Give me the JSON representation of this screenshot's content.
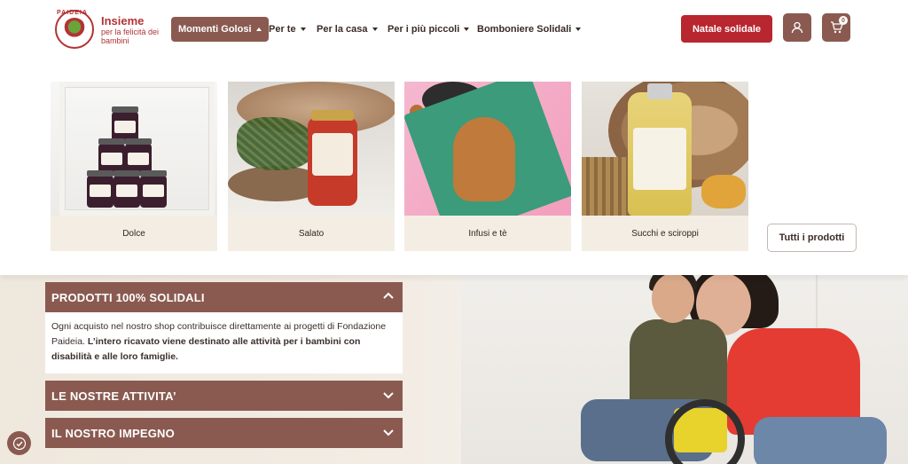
{
  "brand": {
    "logo_text": "PAIDEIA",
    "title": "Insieme",
    "subtitle": "per la felicità dei bambini"
  },
  "nav": {
    "items": [
      {
        "label": "Momenti Golosi",
        "active": true
      },
      {
        "label": "Per te"
      },
      {
        "label": "Per la casa"
      },
      {
        "label": "Per i più piccoli"
      },
      {
        "label": "Bomboniere Solidali"
      }
    ]
  },
  "actions": {
    "natale_label": "Natale solidale",
    "user_icon": "user-icon",
    "cart_icon": "cart-icon",
    "cart_count": "0"
  },
  "mega_menu": {
    "categories": [
      {
        "label": "Dolce"
      },
      {
        "label": "Salato"
      },
      {
        "label": "Infusi e tè"
      },
      {
        "label": "Succhi e sciroppi"
      }
    ],
    "all_products_label": "Tutti i prodotti"
  },
  "accordion": {
    "sections": [
      {
        "title": "PRODOTTI 100% SOLIDALI",
        "expanded": true
      },
      {
        "title": "LE NOSTRE ATTIVITA’",
        "expanded": false
      },
      {
        "title": "IL NOSTRO IMPEGNO",
        "expanded": false
      }
    ],
    "body_text_plain": "Ogni acquisto nel nostro shop contribuisce direttamente ai progetti di Fondazione Paideia. ",
    "body_text_bold": "L’intero ricavato viene destinato alle attività per i bambini con disabilità e alle loro famiglie."
  },
  "colors": {
    "brand_red": "#b33235",
    "accent_brown": "#8a5a50",
    "cta_red": "#b8262f"
  }
}
